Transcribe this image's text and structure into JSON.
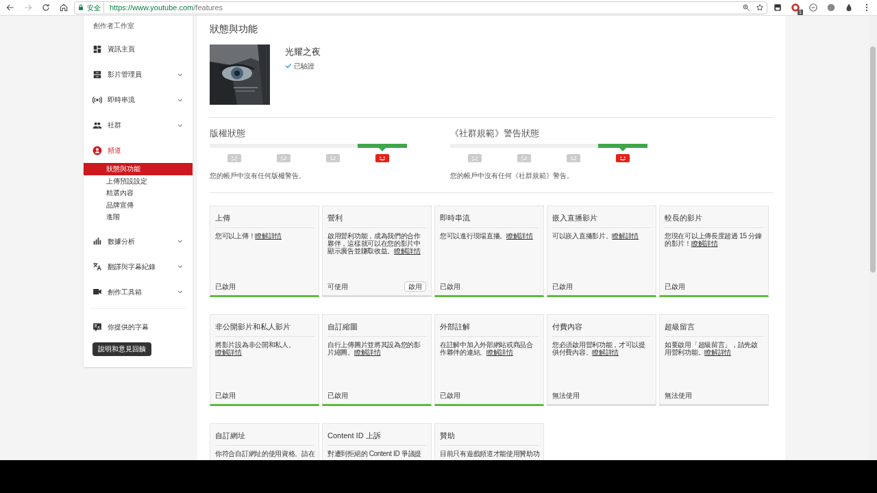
{
  "browser": {
    "secure_label": "安全",
    "url_host": "https://www.youtube.com",
    "url_path": "/features",
    "extension_badge": "1"
  },
  "sidebar": {
    "title": "創作者工作室",
    "items": [
      {
        "kind": "dashboard",
        "label": "資訊主頁",
        "chevron": false,
        "selected": false
      },
      {
        "kind": "videos",
        "label": "影片管理員",
        "chevron": true,
        "selected": false
      },
      {
        "kind": "live",
        "label": "即時串流",
        "chevron": true,
        "selected": false
      },
      {
        "kind": "community",
        "label": "社群",
        "chevron": true,
        "selected": false
      },
      {
        "kind": "channel",
        "label": "頻道",
        "chevron": false,
        "selected": true,
        "children": [
          {
            "label": "狀態與功能",
            "selected": true
          },
          {
            "label": "上傳預設設定",
            "selected": false
          },
          {
            "label": "精選內容",
            "selected": false
          },
          {
            "label": "品牌宣傳",
            "selected": false
          },
          {
            "label": "進階",
            "selected": false
          }
        ]
      },
      {
        "kind": "analytics",
        "label": "數據分析",
        "chevron": true,
        "selected": false
      },
      {
        "kind": "translate",
        "label": "翻譯與字幕紀錄",
        "chevron": true,
        "selected": false
      },
      {
        "kind": "toolbox",
        "label": "創作工具箱",
        "chevron": true,
        "selected": false
      }
    ],
    "extra_item": {
      "kind": "subtitles",
      "label": "你提供的字幕"
    },
    "feedback_button": "說明和意見回饋"
  },
  "page_title": "狀態與功能",
  "channel": {
    "name": "光耀之夜",
    "verified": true,
    "verified_label": "已驗證"
  },
  "strike_meters": [
    {
      "title": "版權狀態",
      "message": "您的帳戶中沒有任何版權警告。",
      "segments": [
        {
          "kind": "sad",
          "selected": false
        },
        {
          "kind": "frown",
          "selected": false
        },
        {
          "kind": "neutral",
          "selected": false
        },
        {
          "kind": "happy",
          "selected": true
        }
      ]
    },
    {
      "title": "《社群規範》警告狀態",
      "message": "您的帳戶中沒有任何《社群規範》警告。",
      "segments": [
        {
          "kind": "sad",
          "selected": false
        },
        {
          "kind": "frown",
          "selected": false
        },
        {
          "kind": "neutral",
          "selected": false
        },
        {
          "kind": "happy",
          "selected": true
        }
      ]
    }
  ],
  "feature_rows": [
    [
      {
        "title": "上傳",
        "description": "您可以上傳！",
        "link": "瞭解詳情",
        "status": "已啟用",
        "enabled": true
      },
      {
        "title": "營利",
        "description": "啟用營利功能，成為我們的合作夥伴，這樣就可以在您的影片中顯示廣告並賺取收益。",
        "link": "瞭解詳情",
        "status": "可使用",
        "enabled": false,
        "action": "啟用"
      },
      {
        "title": "即時串流",
        "description": "您可以進行現場直播。",
        "link": "瞭解詳情",
        "status": "已啟用",
        "enabled": true
      },
      {
        "title": "嵌入直播影片",
        "description": "可以嵌入直播影片。",
        "link": "瞭解詳情",
        "status": "已啟用",
        "enabled": true
      },
      {
        "title": "較長的影片",
        "description": "您現在可以上傳長度超過 15 分鐘的影片！",
        "link": "瞭解詳情",
        "status": "已啟用",
        "enabled": true
      }
    ],
    [
      {
        "title": "非公開影片和私人影片",
        "description": "將影片設為非公開和私人。",
        "link": "瞭解詳情",
        "status": "已啟用",
        "enabled": true
      },
      {
        "title": "自訂縮圖",
        "description": "自行上傳圖片並將其設為您的影片縮圖。",
        "link": "瞭解詳情",
        "status": "已啟用",
        "enabled": true
      },
      {
        "title": "外部註解",
        "description": "在註解中加入外部網站或商品合作夥伴的連結。",
        "link": "瞭解詳情",
        "status": "已啟用",
        "enabled": true
      },
      {
        "title": "付費內容",
        "description": "您必須啟用營利功能，才可以提供付費內容。",
        "link": "瞭解詳情",
        "status": "無法使用",
        "enabled": false
      },
      {
        "title": "超級留言",
        "description": "如要啟用「超級留言」，請先啟用營利功能。",
        "link": "瞭解詳情",
        "status": "無法使用",
        "enabled": false
      }
    ],
    [
      {
        "title": "自訂網址",
        "description": "你符合自訂網址的使用資格。請在"
      },
      {
        "title": "Content ID 上訴",
        "description": "對遭到拒絕的 Content ID 爭議提"
      },
      {
        "title": "贊助",
        "description": "目前只有遊戲頻道才能使用贊助功"
      }
    ]
  ]
}
